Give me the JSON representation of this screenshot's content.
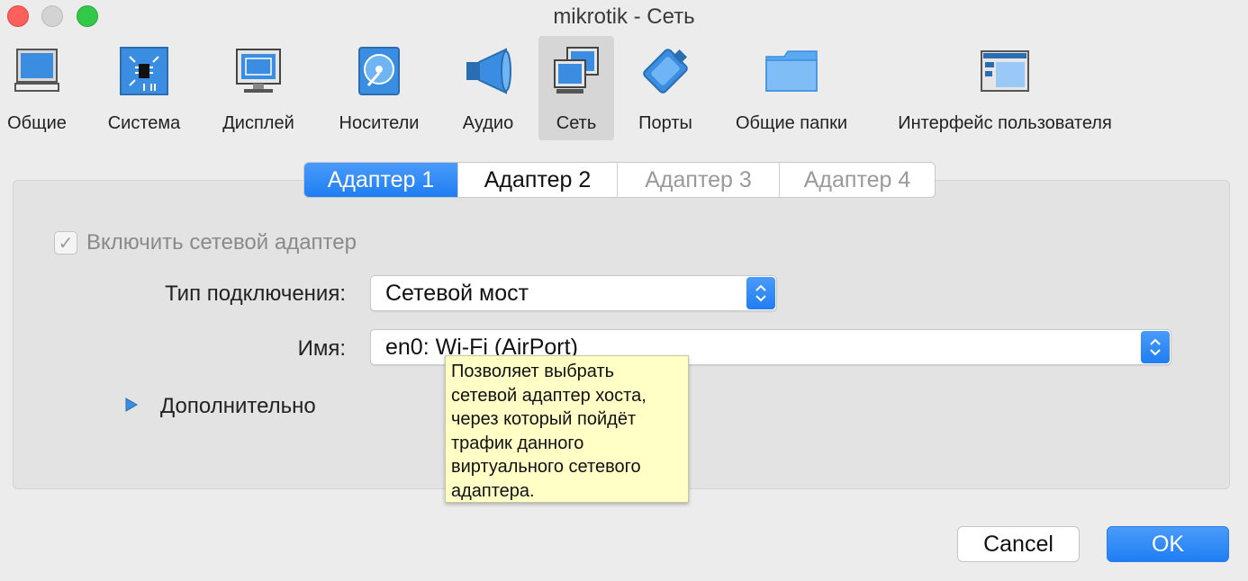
{
  "window": {
    "title": "mikrotik - Сеть"
  },
  "toolbar": {
    "items": [
      {
        "label": "Общие",
        "icon": "monitor-general-icon"
      },
      {
        "label": "Система",
        "icon": "chip-icon"
      },
      {
        "label": "Дисплей",
        "icon": "display-icon"
      },
      {
        "label": "Носители",
        "icon": "disk-icon"
      },
      {
        "label": "Аудио",
        "icon": "speaker-icon"
      },
      {
        "label": "Сеть",
        "icon": "network-icon",
        "selected": true
      },
      {
        "label": "Порты",
        "icon": "serial-port-icon"
      },
      {
        "label": "Общие папки",
        "icon": "folder-icon"
      },
      {
        "label": "Интерфейс пользователя",
        "icon": "ui-window-icon"
      }
    ]
  },
  "tabs": [
    {
      "label": "Адаптер 1",
      "state": "active"
    },
    {
      "label": "Адаптер 2",
      "state": "normal"
    },
    {
      "label": "Адаптер 3",
      "state": "disabled"
    },
    {
      "label": "Адаптер 4",
      "state": "disabled"
    }
  ],
  "adapter": {
    "enable_label": "Включить сетевой адаптер",
    "enable_checked": true,
    "attached_label": "Тип подключения:",
    "attached_value": "Сетевой мост",
    "name_label": "Имя:",
    "name_value": "en0: Wi-Fi (AirPort)",
    "advanced_label": "Дополнительно"
  },
  "tooltip": {
    "lines": [
      "Позволяет выбрать",
      "сетевой адаптер хоста,",
      "через который пойдёт",
      "трафик данного",
      "виртуального сетевого",
      "адаптера."
    ]
  },
  "buttons": {
    "cancel": "Cancel",
    "ok": "OK"
  },
  "colors": {
    "accent": "#1f7ef2",
    "tooltip_bg": "#ffffc6",
    "window_bg": "#ececec"
  }
}
